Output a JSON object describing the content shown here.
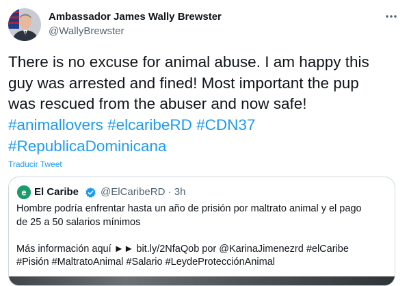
{
  "author": {
    "name": "Ambassador James Wally Brewster",
    "handle": "@WallyBrewster"
  },
  "tweet": {
    "text_lines": [
      "There is no excuse for animal abuse. I am happy this",
      "guy was arrested and fined!  Most important the pup",
      "was rescued from the abuser and now safe!"
    ],
    "hashtags": [
      "#animallovers",
      "#elcaribeRD",
      "#CDN37",
      "#RepublicaDominicana"
    ],
    "translate_label": "Traducir Tweet"
  },
  "quoted": {
    "name": "El Caribe",
    "handle_time": "@ElCaribeRD · 3h",
    "text_lines": [
      "Hombre podría enfrentar hasta un año de prisión por maltrato animal y el pago",
      "de 25 a 50 salarios mínimos",
      "",
      "Más información aquí ►► bit.ly/2NfaQob por @KarinaJimenezrd #elCaribe",
      "#Pisión #MaltratoAnimal  #Salario #LeydeProtecciónAnimal"
    ]
  },
  "colors": {
    "link": "#1d9bf0",
    "secondary_text": "#536471",
    "border": "#cfd9de",
    "verified": "#1d9bf0"
  },
  "icons": {
    "more": "more-horizontal-icon",
    "verified": "verified-badge-icon",
    "quote_avatar": "el-caribe-logo"
  }
}
